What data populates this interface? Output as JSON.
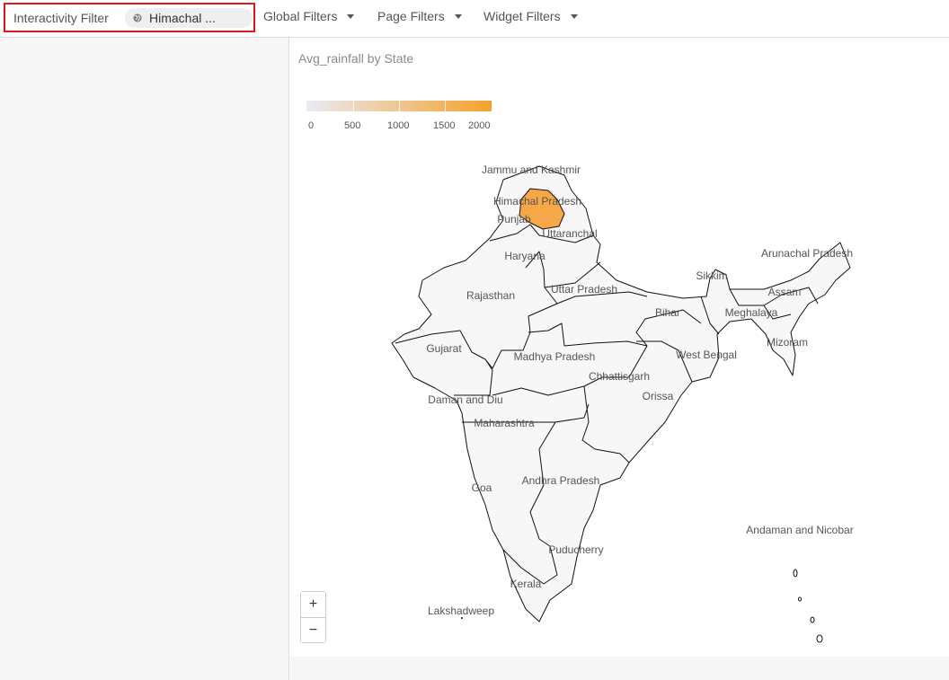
{
  "filters": {
    "interactivity_label": "Interactivity Filter",
    "interactivity_value": "Himachal ...",
    "global_label": "Global Filters",
    "page_label": "Page Filters",
    "widget_label": "Widget Filters"
  },
  "widget": {
    "title": "Avg_rainfall by State",
    "zoom_in": "+",
    "zoom_out": "−"
  },
  "legend": {
    "min_color": "#e9ebf6",
    "max_color": "#f5a12b",
    "ticks": [
      "0",
      "500",
      "1000",
      "1500",
      "2000"
    ]
  },
  "map_data": {
    "highlight_color": "#f5a845",
    "default_color": "#f7f7f7",
    "highlighted_state": "Himachal Pradesh",
    "labels": [
      "Jammu and Kashmir",
      "Himachal Pradesh",
      "Punjab",
      "Uttaranchal",
      "Haryana",
      "Rajasthan",
      "Uttar Pradesh",
      "Sikkim",
      "Arunachal Pradesh",
      "Assam",
      "Bihar",
      "Meghalaya",
      "Mizoram",
      "Gujarat",
      "Madhya Pradesh",
      "West Bengal",
      "Chhattisgarh",
      "Daman and Diu",
      "Orissa",
      "Maharashtra",
      "Goa",
      "Andhra Pradesh",
      "Andaman and Nicobar",
      "Puducherry",
      "Kerala",
      "Lakshadweep"
    ]
  }
}
